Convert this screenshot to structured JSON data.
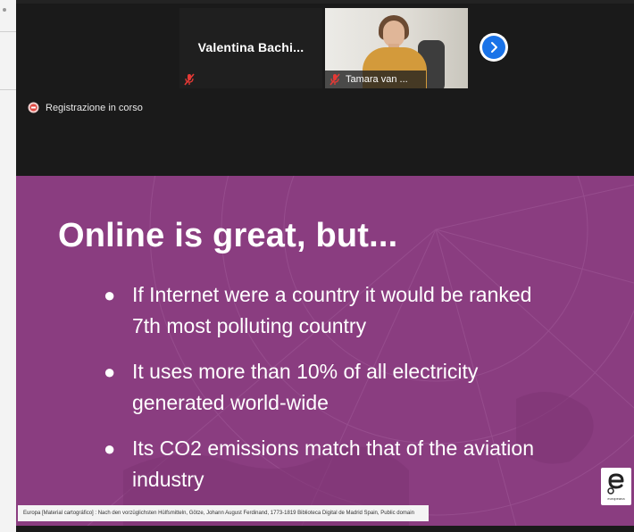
{
  "participants": {
    "valentina": {
      "name": "Valentina  Bachi..."
    },
    "tamara": {
      "name": "Tamara van ..."
    }
  },
  "recording": {
    "label": "Registrazione in corso"
  },
  "slide": {
    "title": "Online is great, but...",
    "bullets": [
      {
        "line1": "If Internet were a country it would be ranked",
        "line2": "7th most polluting country"
      },
      {
        "line1": "It uses more than 10% of all electricity",
        "line2": "generated world-wide"
      },
      {
        "line1": "Its CO2 emissions match that of the aviation",
        "line2": "industry"
      }
    ],
    "bullet_glyph": "●",
    "credit": "Europa [Material cartográfico] : Nach den vorzüglichsten Hülfsmitteln, Götze, Johann August Ferdinand, 1773-1819 Biblioteca Digital de Madrid Spain, Public domain",
    "logo_text": "europeana"
  },
  "colors": {
    "slide_background": "#8a3d80",
    "meeting_background": "#1a1a1a",
    "accent_blue": "#1a73e8",
    "muted_red": "#e53935"
  },
  "icons": {
    "muted": "microphone-muted-icon",
    "next": "chevron-right-icon",
    "recording": "record-icon",
    "logo": "europeana-logo-icon"
  }
}
